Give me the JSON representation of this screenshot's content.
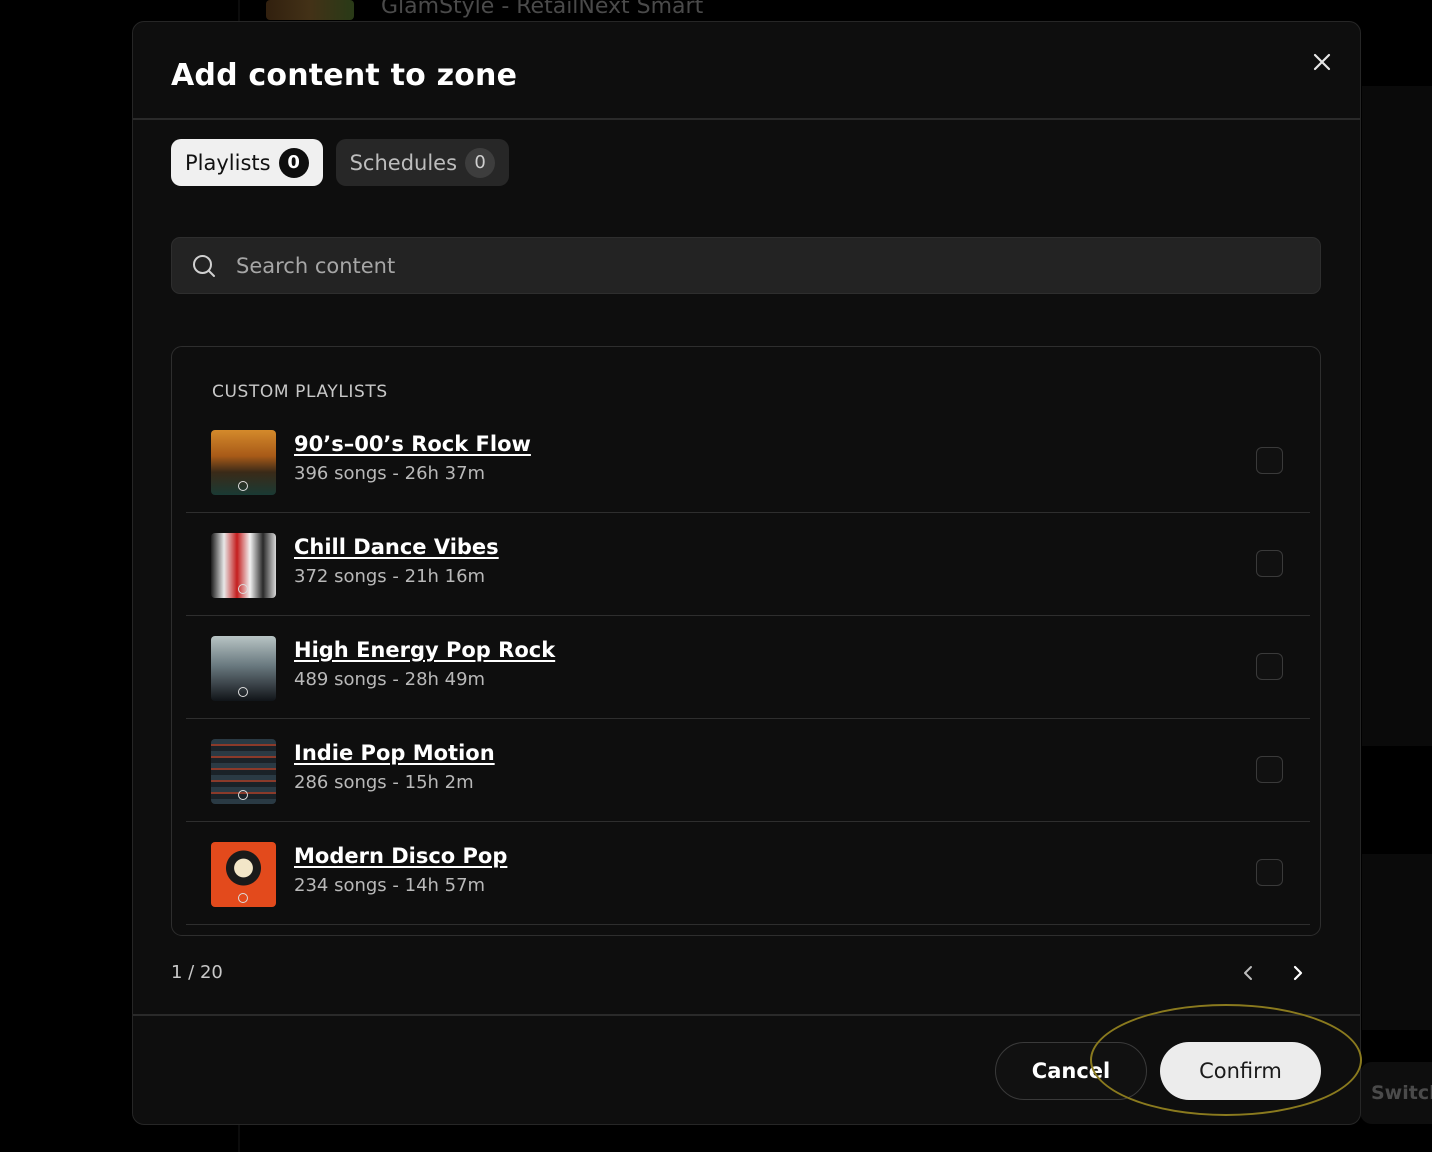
{
  "background": {
    "top_item_title": "GlamStyle - RetailNext Smart",
    "switch_label": "Switch"
  },
  "modal": {
    "title": "Add content to zone",
    "close_icon": "close-icon",
    "tabs": [
      {
        "label": "Playlists",
        "count": "0",
        "active": true
      },
      {
        "label": "Schedules",
        "count": "0",
        "active": false
      }
    ],
    "search": {
      "placeholder": "Search content",
      "value": ""
    },
    "section_label": "CUSTOM PLAYLISTS",
    "playlists": [
      {
        "title": "90’s–00’s Rock Flow",
        "meta": "396 songs - 26h 37m",
        "checked": false
      },
      {
        "title": "Chill Dance Vibes",
        "meta": "372 songs - 21h 16m",
        "checked": false
      },
      {
        "title": "High Energy Pop Rock",
        "meta": "489 songs - 28h 49m",
        "checked": false
      },
      {
        "title": "Indie Pop Motion",
        "meta": "286 songs - 15h 2m",
        "checked": false
      },
      {
        "title": "Modern Disco Pop",
        "meta": "234 songs - 14h 57m",
        "checked": false
      }
    ],
    "pagination": {
      "text": "1 / 20"
    },
    "footer": {
      "cancel_label": "Cancel",
      "confirm_label": "Confirm"
    }
  },
  "colors": {
    "accent_ring": "#8a7a1e",
    "modal_bg": "#0e0e0e",
    "primary_button": "#ececec"
  }
}
